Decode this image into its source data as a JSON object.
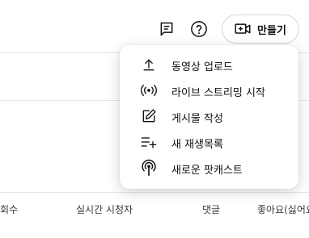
{
  "header": {
    "create_label": "만들기"
  },
  "icons": {
    "feedback": "feedback-icon",
    "help": "help-icon",
    "create": "video-plus-icon"
  },
  "menu": {
    "items": [
      {
        "label": "동영상 업로드",
        "icon": "upload-icon"
      },
      {
        "label": "라이브 스트리밍 시작",
        "icon": "live-icon"
      },
      {
        "label": "게시물 작성",
        "icon": "edit-icon"
      },
      {
        "label": "새 재생목록",
        "icon": "playlist-add-icon"
      },
      {
        "label": "새로운 팟캐스트",
        "icon": "podcast-icon"
      }
    ]
  },
  "table": {
    "headers": [
      "회수",
      "실시간 시청자",
      "댓글",
      "좋아요(싫어요"
    ]
  }
}
